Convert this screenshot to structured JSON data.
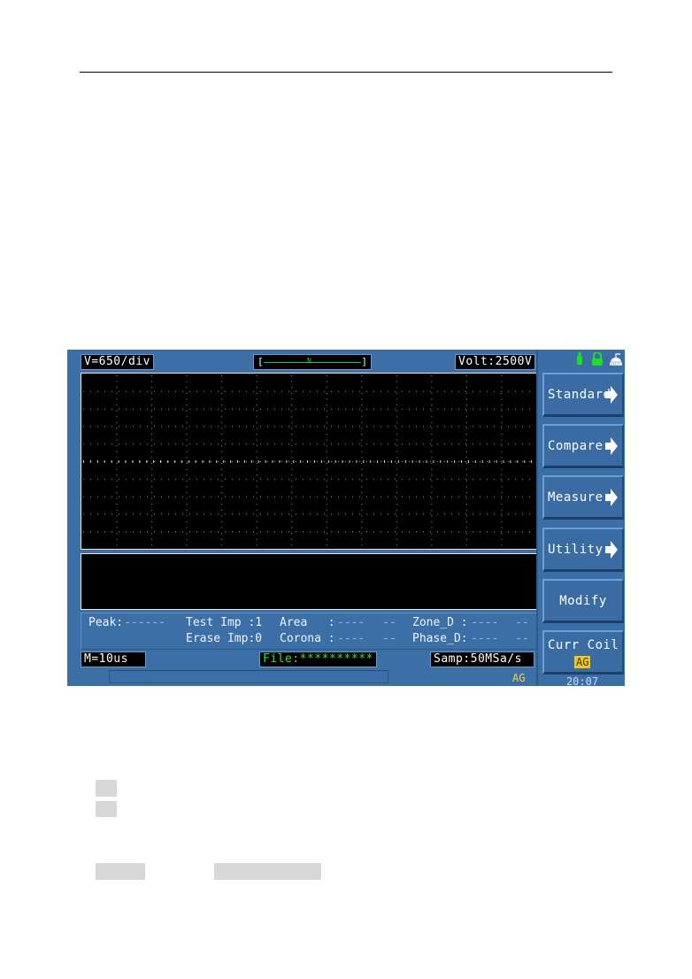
{
  "screen": {
    "header": {
      "voltage_scale": "V=650/div",
      "trigger_marker": "N",
      "trigger_left_bracket": "[",
      "trigger_right_bracket": "]",
      "voltage": "Volt:2500V"
    },
    "status_icons": [
      "usb-icon",
      "lock-icon",
      "printer-icon"
    ],
    "grid": {
      "horizontal_divisions": 13,
      "vertical_divisions": 10
    },
    "measurements": {
      "peak_label": "Peak:",
      "peak_value": "------",
      "test_imp": "Test Imp :1",
      "erase_imp": "Erase Imp:0",
      "area_label": "Area   :",
      "area_value": "----",
      "area_unit": "--",
      "corona_label": "Corona :",
      "corona_value": "----",
      "corona_unit": "--",
      "zone_d_label": "Zone_D :",
      "zone_d_value": "----",
      "zone_d_unit": "--",
      "phase_d_label": "Phase_D:",
      "phase_d_value": "----",
      "phase_d_unit": "--"
    },
    "footer": {
      "time_base": "M=10us",
      "file": "File:**********",
      "sample_rate": "Samp:50MSa/s",
      "coil_indicator": "AG"
    },
    "side_menu": {
      "buttons": [
        {
          "label": "Standard",
          "has_arrow": true
        },
        {
          "label": "Compare",
          "has_arrow": true
        },
        {
          "label": "Measure",
          "has_arrow": true
        },
        {
          "label": "Utility",
          "has_arrow": true
        },
        {
          "label": "Modify",
          "has_arrow": false
        },
        {
          "label": "Curr Coil",
          "value": "AG",
          "has_arrow": false
        }
      ],
      "clock": "20:07"
    }
  },
  "colors": {
    "panel_blue": "#3a6ea5",
    "label_green": "#34e034",
    "highlight_yellow": "#f2c61f"
  }
}
